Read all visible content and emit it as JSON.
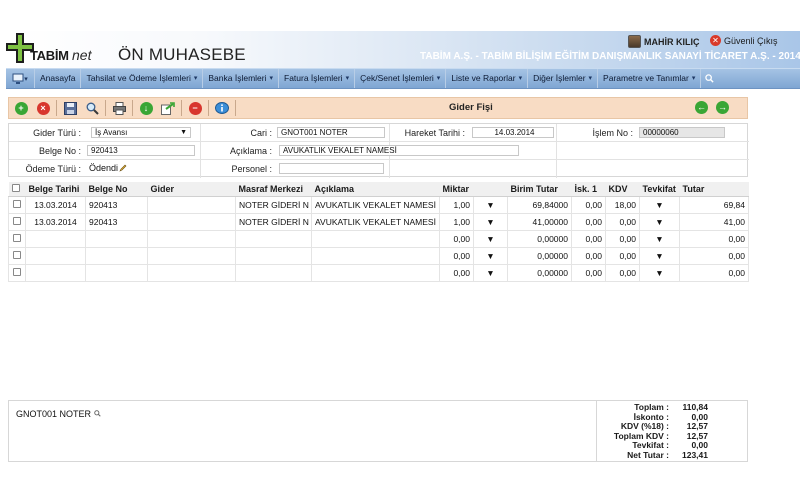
{
  "header": {
    "logo_main": "TABİM",
    "logo_suffix": "net",
    "app_title": "ÖN MUHASEBE",
    "company": "TABİM A.Ş. - TABİM BİLİŞİM EĞİTİM DANIŞMANLIK SANAYİ TİCARET A.Ş. - 2014",
    "user_name": "MAHİR KILIÇ",
    "logout_label": "Güvenli Çıkış"
  },
  "menu": {
    "items": [
      "Anasayfa",
      "Tahsilat ve Ödeme İşlemleri",
      "Banka İşlemleri",
      "Fatura İşlemleri",
      "Çek/Senet İşlemleri",
      "Liste ve Raporlar",
      "Diğer İşlemler",
      "Parametre ve Tanımlar"
    ]
  },
  "toolbar": {
    "title": "Gider Fişi"
  },
  "form": {
    "gider_turu_label": "Gider Türü :",
    "gider_turu_value": "İş Avansı",
    "cari_label": "Cari :",
    "cari_value": "GNOT001 NOTER",
    "hareket_tarihi_label": "Hareket Tarihi :",
    "hareket_tarihi_value": "14.03.2014",
    "islem_no_label": "İşlem No :",
    "islem_no_value": "00000060",
    "belge_no_label": "Belge No :",
    "belge_no_value": "920413",
    "aciklama_label": "Açıklama :",
    "aciklama_value": "AVUKATLIK VEKALET NAMESİ",
    "odeme_turu_label": "Ödeme Türü :",
    "odeme_turu_value": "Ödendi",
    "personel_label": "Personel :",
    "personel_value": ""
  },
  "grid": {
    "columns": [
      "Belge Tarihi",
      "Belge No",
      "Gider",
      "Masraf Merkezi",
      "Açıklama",
      "Miktar",
      "",
      "Birim Tutar",
      "İsk. 1",
      "KDV",
      "Tevkifat",
      "Tutar"
    ],
    "rows": [
      {
        "belge_tarihi": "13.03.2014",
        "belge_no": "920413",
        "gider": "",
        "masraf_merkezi": "NOTER GİDERİ N",
        "aciklama": "AVUKATLIK VEKALET NAMESİ",
        "miktar": "1,00",
        "birim_tutar": "69,84000",
        "isk1": "0,00",
        "kdv": "18,00",
        "tutar": "69,84"
      },
      {
        "belge_tarihi": "13.03.2014",
        "belge_no": "920413",
        "gider": "",
        "masraf_merkezi": "NOTER GİDERİ N",
        "aciklama": "AVUKATLIK VEKALET NAMESİ",
        "miktar": "1,00",
        "birim_tutar": "41,00000",
        "isk1": "0,00",
        "kdv": "0,00",
        "tutar": "41,00"
      },
      {
        "belge_tarihi": "",
        "belge_no": "",
        "gider": "",
        "masraf_merkezi": "",
        "aciklama": "",
        "miktar": "0,00",
        "birim_tutar": "0,00000",
        "isk1": "0,00",
        "kdv": "0,00",
        "tutar": "0,00"
      },
      {
        "belge_tarihi": "",
        "belge_no": "",
        "gider": "",
        "masraf_merkezi": "",
        "aciklama": "",
        "miktar": "0,00",
        "birim_tutar": "0,00000",
        "isk1": "0,00",
        "kdv": "0,00",
        "tutar": "0,00"
      },
      {
        "belge_tarihi": "",
        "belge_no": "",
        "gider": "",
        "masraf_merkezi": "",
        "aciklama": "",
        "miktar": "0,00",
        "birim_tutar": "0,00000",
        "isk1": "0,00",
        "kdv": "0,00",
        "tutar": "0,00"
      }
    ]
  },
  "footer": {
    "cari_info": "GNOT001 NOTER",
    "totals": [
      {
        "label": "Toplam :",
        "value": "110,84"
      },
      {
        "label": "İskonto :",
        "value": "0,00"
      },
      {
        "label": "KDV (%18) :",
        "value": "12,57"
      },
      {
        "label": "Toplam KDV :",
        "value": "12,57"
      },
      {
        "label": "Tevkifat :",
        "value": "0,00"
      },
      {
        "label": "Net Tutar :",
        "value": "123,41"
      }
    ]
  },
  "icons": {
    "new": "plus-circle-icon",
    "delete": "x-circle-icon",
    "save": "floppy-icon",
    "search": "magnifier-icon",
    "print": "printer-icon",
    "download": "arrow-down-circle-icon",
    "export": "export-icon",
    "cancel": "stop-circle-icon",
    "info": "info-icon"
  },
  "colors": {
    "toolbar_bg": "#f8dcc4",
    "menubar": "#8fb2dc",
    "company_text": "#ffffff"
  }
}
